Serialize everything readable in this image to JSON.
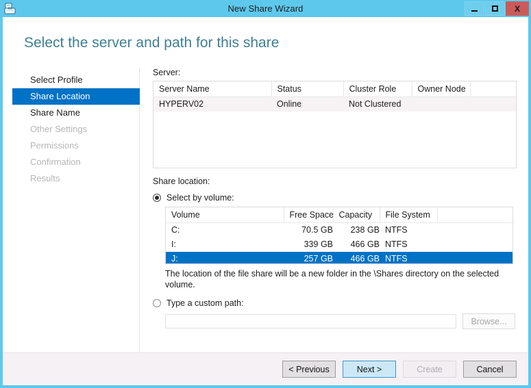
{
  "window": {
    "title": "New Share Wizard",
    "icon": "share-wizard-icon",
    "minimize_label": "Minimize",
    "maximize_label": "Maximize",
    "close_label": "X",
    "accent_color": "#5ec8ec",
    "selection_color": "#0072c6"
  },
  "page": {
    "heading": "Select the server and path for this share"
  },
  "nav": {
    "items": [
      {
        "label": "Select Profile",
        "state": "enabled"
      },
      {
        "label": "Share Location",
        "state": "selected"
      },
      {
        "label": "Share Name",
        "state": "enabled"
      },
      {
        "label": "Other Settings",
        "state": "disabled"
      },
      {
        "label": "Permissions",
        "state": "disabled"
      },
      {
        "label": "Confirmation",
        "state": "disabled"
      },
      {
        "label": "Results",
        "state": "disabled"
      }
    ]
  },
  "server_section": {
    "label": "Server:",
    "columns": [
      "Server Name",
      "Status",
      "Cluster Role",
      "Owner Node",
      ""
    ],
    "rows": [
      {
        "server_name": "HYPERV02",
        "status": "Online",
        "cluster_role": "Not Clustered",
        "owner_node": ""
      }
    ]
  },
  "share_location": {
    "label": "Share location:",
    "select_by_volume": {
      "label": "Select by volume:",
      "checked": true
    },
    "volume_columns": [
      "Volume",
      "Free Space",
      "Capacity",
      "File System",
      ""
    ],
    "volumes": [
      {
        "volume": "C:",
        "free_space": "70.5 GB",
        "capacity": "238 GB",
        "file_system": "NTFS",
        "selected": false
      },
      {
        "volume": "I:",
        "free_space": "339 GB",
        "capacity": "466 GB",
        "file_system": "NTFS",
        "selected": false
      },
      {
        "volume": "J:",
        "free_space": "257 GB",
        "capacity": "466 GB",
        "file_system": "NTFS",
        "selected": true
      }
    ],
    "hint": "The location of the file share will be a new folder in the \\Shares directory on the selected volume.",
    "custom_path": {
      "label": "Type a custom path:",
      "checked": false,
      "value": "",
      "placeholder": "",
      "browse_label": "Browse..."
    }
  },
  "footer": {
    "previous_label": "< Previous",
    "next_label": "Next >",
    "create_label": "Create",
    "cancel_label": "Cancel"
  }
}
